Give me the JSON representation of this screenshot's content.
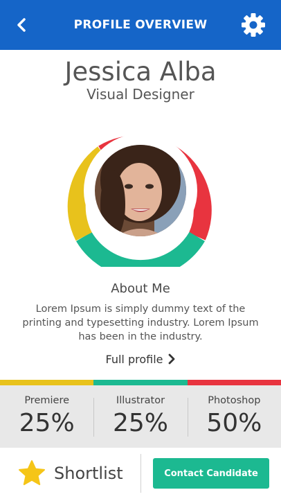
{
  "header": {
    "title": "PROFILE OVERVIEW",
    "back_icon": "chevron-left-icon",
    "settings_icon": "gear-icon",
    "color": "#1565c8"
  },
  "profile": {
    "name": "Jessica Alba",
    "role": "Visual Designer",
    "ring_colors": {
      "red": "#e8343f",
      "yellow": "#e8c21c",
      "green": "#1cb991"
    }
  },
  "about": {
    "title": "About Me",
    "text": "Lorem Ipsum is simply dummy text of the printing and typesetting industry. Lorem Ipsum has been in the industry.",
    "link_label": "Full profile"
  },
  "skills": [
    {
      "label": "Premiere",
      "value": "25%",
      "color": "#e8c21c"
    },
    {
      "label": "Illustrator",
      "value": "25%",
      "color": "#1cb991"
    },
    {
      "label": "Photoshop",
      "value": "50%",
      "color": "#e8343f"
    }
  ],
  "footer": {
    "shortlist_label": "Shortlist",
    "star_icon": "star-icon",
    "contact_label": "Contact Candidate",
    "contact_color": "#1cb991"
  }
}
